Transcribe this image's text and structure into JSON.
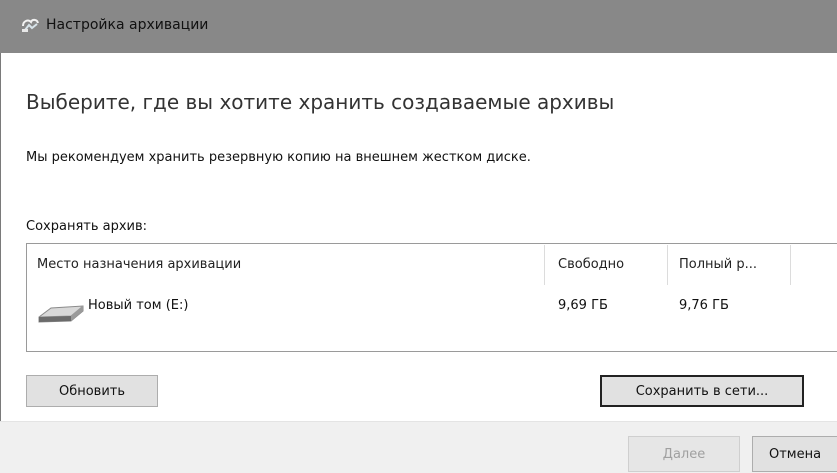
{
  "window": {
    "title": "Настройка архивации",
    "title_icon": "backup-icon"
  },
  "main": {
    "heading": "Выберите, где вы хотите хранить создаваемые архивы",
    "recommend": "Мы рекомендуем хранить резервную копию на внешнем жестком диске.",
    "save_label": "Сохранять архив:"
  },
  "destinations": {
    "columns": [
      "Место назначения архивации",
      "Свободно",
      "Полный р..."
    ],
    "rows": [
      {
        "icon": "drive-icon",
        "name": "Новый том (E:)",
        "free": "9,69 ГБ",
        "total": "9,76 ГБ"
      }
    ]
  },
  "buttons": {
    "refresh": "Обновить",
    "save_network": "Сохранить в сети...",
    "next": "Далее",
    "cancel": "Отмена"
  }
}
